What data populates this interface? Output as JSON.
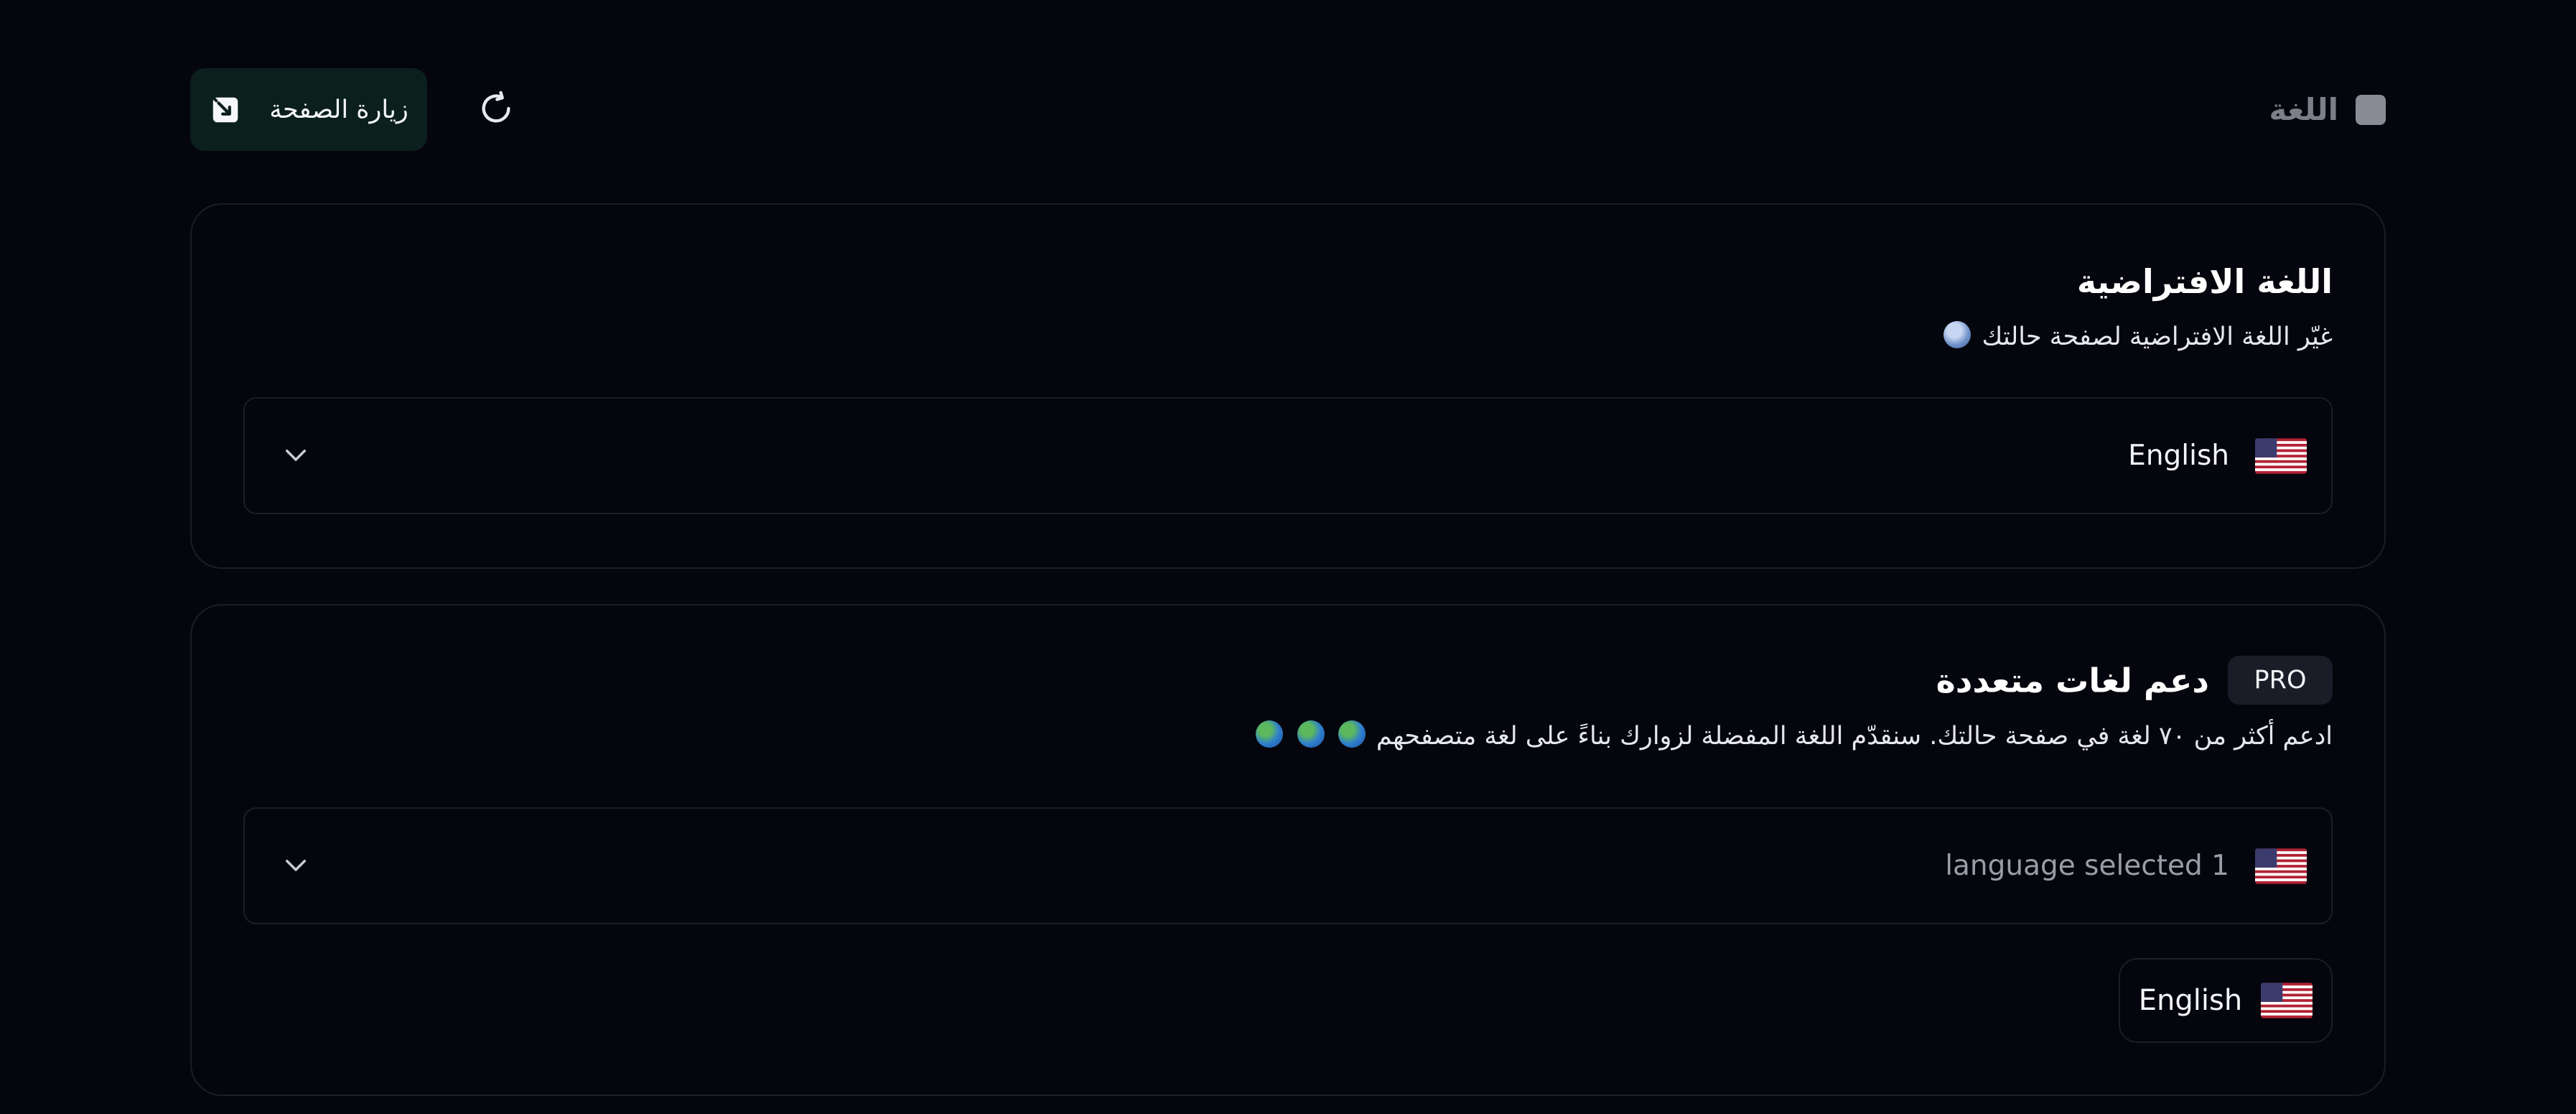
{
  "header": {
    "section_title": "اللغة",
    "visit_button_label": "زيارة الصفحة",
    "visit_icon": "external-link-icon",
    "refresh_icon": "refresh-icon"
  },
  "default_language": {
    "title": "اللغة الافتراضية",
    "subtitle": "غيّر اللغة الافتراضية لصفحة حالتك",
    "subtitle_emoji": "globe-with-meridians-icon",
    "selected_value": "English",
    "selected_flag": "us-flag-icon"
  },
  "multi_language": {
    "title": "دعم لغات متعددة",
    "badge": "PRO",
    "subtitle": "ادعم أكثر من ٧٠ لغة في صفحة حالتك. سنقدّم اللغة المفضلة لزوارك بناءً على لغة متصفحهم",
    "subtitle_emojis": [
      "globe-africa-icon",
      "globe-americas-icon",
      "globe-asia-icon"
    ],
    "select_value": "language selected 1",
    "select_flag": "us-flag-icon",
    "chips": [
      {
        "label": "English",
        "flag": "us-flag-icon"
      }
    ]
  },
  "colors": {
    "background": "#05060d",
    "card_border": "#1b1d27",
    "visit_button_bg": "#0b1f1c",
    "badge_bg": "#1a1d28",
    "muted_text": "#7d7f88"
  }
}
